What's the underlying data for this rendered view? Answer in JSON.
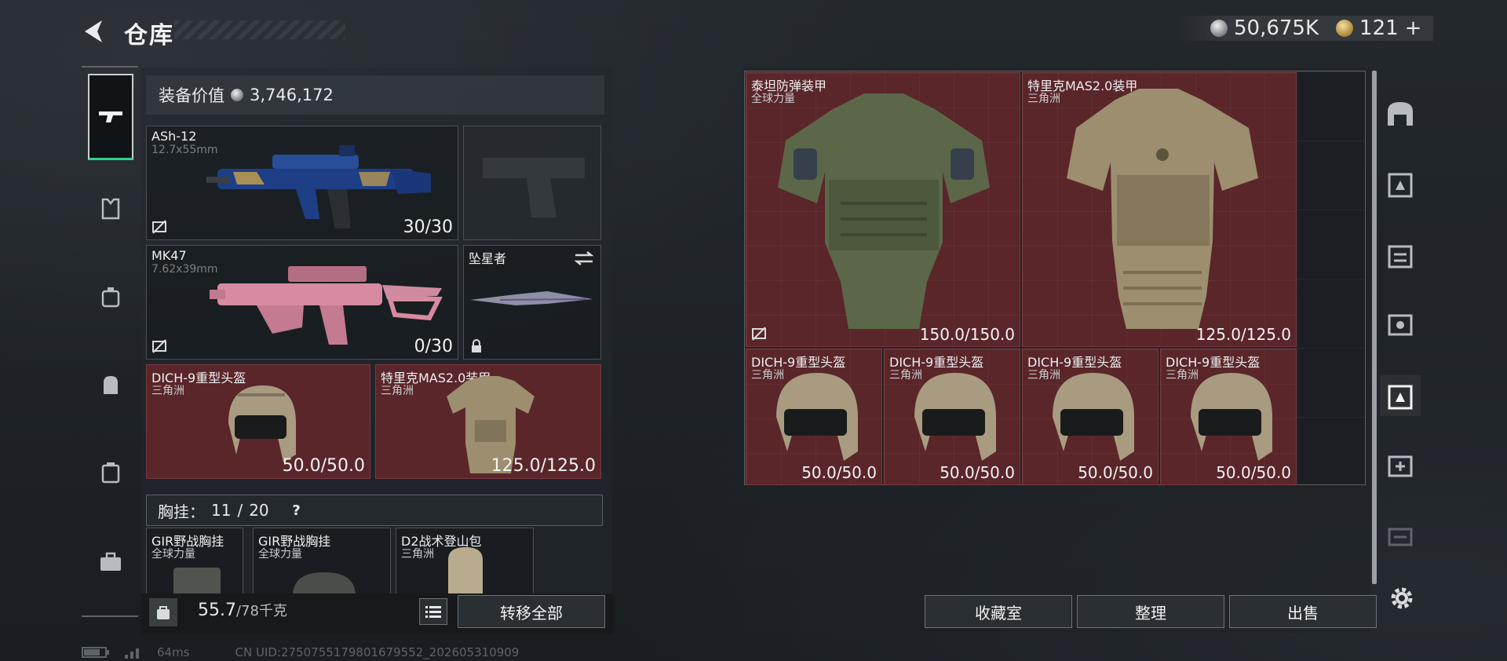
{
  "header": {
    "title": "仓库"
  },
  "currency": {
    "silver": "50,675K",
    "gold": "121",
    "gold_plus": "+"
  },
  "left_nav": {
    "items": [
      "firearm-icon",
      "armor-icon",
      "chest-rig-icon",
      "backpack-icon",
      "safe-box-icon",
      "toolbox-icon"
    ]
  },
  "equipment": {
    "value_label": "装备价值",
    "value": "3,746,172",
    "primary": {
      "name": "ASh-12",
      "caliber": "12.7x55mm",
      "ammo": "30/30"
    },
    "sidearm": {
      "name": "",
      "ammo": ""
    },
    "secondary": {
      "name": "MK47",
      "caliber": "7.62x39mm",
      "ammo": "0/30"
    },
    "melee": {
      "name": "坠星者"
    },
    "helmet": {
      "name": "DICH-9重型头盔",
      "source": "三角洲",
      "durability": "50.0/50.0"
    },
    "armor": {
      "name": "特里克MAS2.0装甲",
      "source": "三角洲",
      "durability": "125.0/125.0"
    }
  },
  "chest_rig": {
    "label": "胸挂：",
    "used": "11",
    "max": "20",
    "help": "?"
  },
  "rig_items": [
    {
      "name": "GIR野战胸挂",
      "source": "全球力量"
    },
    {
      "name": "GIR野战胸挂",
      "source": "全球力量"
    },
    {
      "name": "D2战术登山包",
      "source": "三角洲"
    }
  ],
  "bottom": {
    "weight": "55.7",
    "weight_max": "/78千克",
    "transfer_all": "转移全部"
  },
  "storage": {
    "items": [
      {
        "name": "泰坦防弹装甲",
        "source": "全球力量",
        "durability": "150.0/150.0"
      },
      {
        "name": "特里克MAS2.0装甲",
        "source": "三角洲",
        "durability": "125.0/125.0"
      },
      {
        "name": "DICH-9重型头盔",
        "source": "三角洲",
        "durability": "50.0/50.0"
      },
      {
        "name": "DICH-9重型头盔",
        "source": "三角洲",
        "durability": "50.0/50.0"
      },
      {
        "name": "DICH-9重型头盔",
        "source": "三角洲",
        "durability": "50.0/50.0"
      },
      {
        "name": "DICH-9重型头盔",
        "source": "三角洲",
        "durability": "50.0/50.0"
      }
    ]
  },
  "right_nav": {
    "items": [
      "storage-dome-icon",
      "armor-rack-icon",
      "level-iv-rack-icon",
      "level-iv-cabinet-icon",
      "armor-rack-active-icon",
      "level-iv-medical-icon",
      "level-iii-rack-icon"
    ]
  },
  "actions": {
    "collection": "收藏室",
    "sort": "整理",
    "sell": "出售"
  },
  "status": {
    "ping": "64ms",
    "uid": "CN UID:275075517980167955​2_202605310909"
  },
  "colors": {
    "item_red": "#5a2629",
    "accent_green": "#2fd28a"
  }
}
